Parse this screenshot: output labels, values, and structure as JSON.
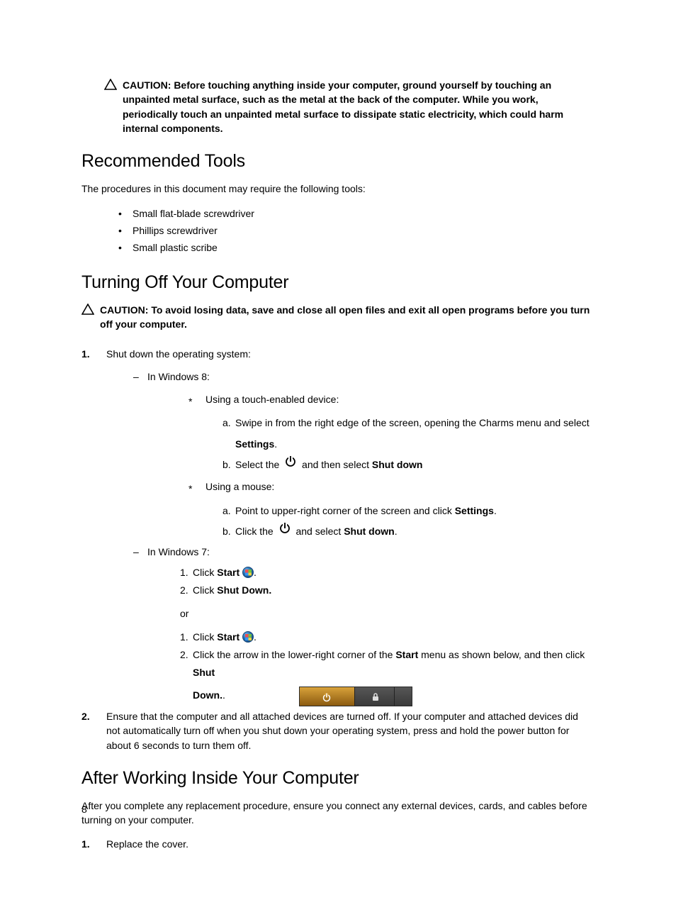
{
  "caution1": "CAUTION: Before touching anything inside your computer, ground yourself by touching an unpainted metal surface, such as the metal at the back of the computer. While you work, periodically touch an unpainted metal surface to dissipate static electricity, which could harm internal components.",
  "section1": {
    "title": "Recommended Tools",
    "intro": "The procedures in this document may require the following tools:",
    "tools": [
      "Small flat-blade screwdriver",
      "Phillips screwdriver",
      "Small plastic scribe"
    ]
  },
  "section2": {
    "title": "Turning Off Your Computer",
    "caution": "CAUTION: To avoid losing data, save and close all open files and exit all open programs before you turn off your computer.",
    "step1": "Shut down the operating system:",
    "win8": "In Windows 8:",
    "touch_label": "Using a touch-enabled device:",
    "touch_a_pre": "Swipe in from the right edge of the screen, opening the Charms menu and select ",
    "touch_a_bold": "Settings",
    "touch_a_post": ".",
    "touch_b_pre": "Select the ",
    "touch_b_mid": " and then select ",
    "touch_b_bold": "Shut down",
    "mouse_label": "Using a mouse:",
    "mouse_a_pre": "Point to upper-right corner of the screen and click ",
    "mouse_a_bold": "Settings",
    "mouse_a_post": ".",
    "mouse_b_pre": "Click the ",
    "mouse_b_mid": " and select ",
    "mouse_b_bold": "Shut down",
    "mouse_b_post": ".",
    "win7": "In Windows 7:",
    "w7_1_pre": "Click ",
    "w7_1_bold": "Start",
    "w7_1_post": ".",
    "w7_2_pre": "Click ",
    "w7_2_bold": "Shut Down.",
    "or": "or",
    "w7b_1_pre": "Click ",
    "w7b_1_bold": "Start",
    "w7b_1_post": ".",
    "w7b_2_pre": "Click the arrow in the lower-right corner of the ",
    "w7b_2_bold1": "Start",
    "w7b_2_mid": " menu as shown below, and then click ",
    "w7b_2_bold2": "Shut Down.",
    "w7b_2_post": ".",
    "step2": "Ensure that the computer and all attached devices are turned off. If your computer and attached devices did not automatically turn off when you shut down your operating system, press and hold the power button for about 6 seconds to turn them off."
  },
  "section3": {
    "title": "After Working Inside Your Computer",
    "intro": "After you complete any replacement procedure, ensure you connect any external devices, cards, and cables before turning on your computer.",
    "step1": "Replace the cover."
  },
  "page_number": "8"
}
